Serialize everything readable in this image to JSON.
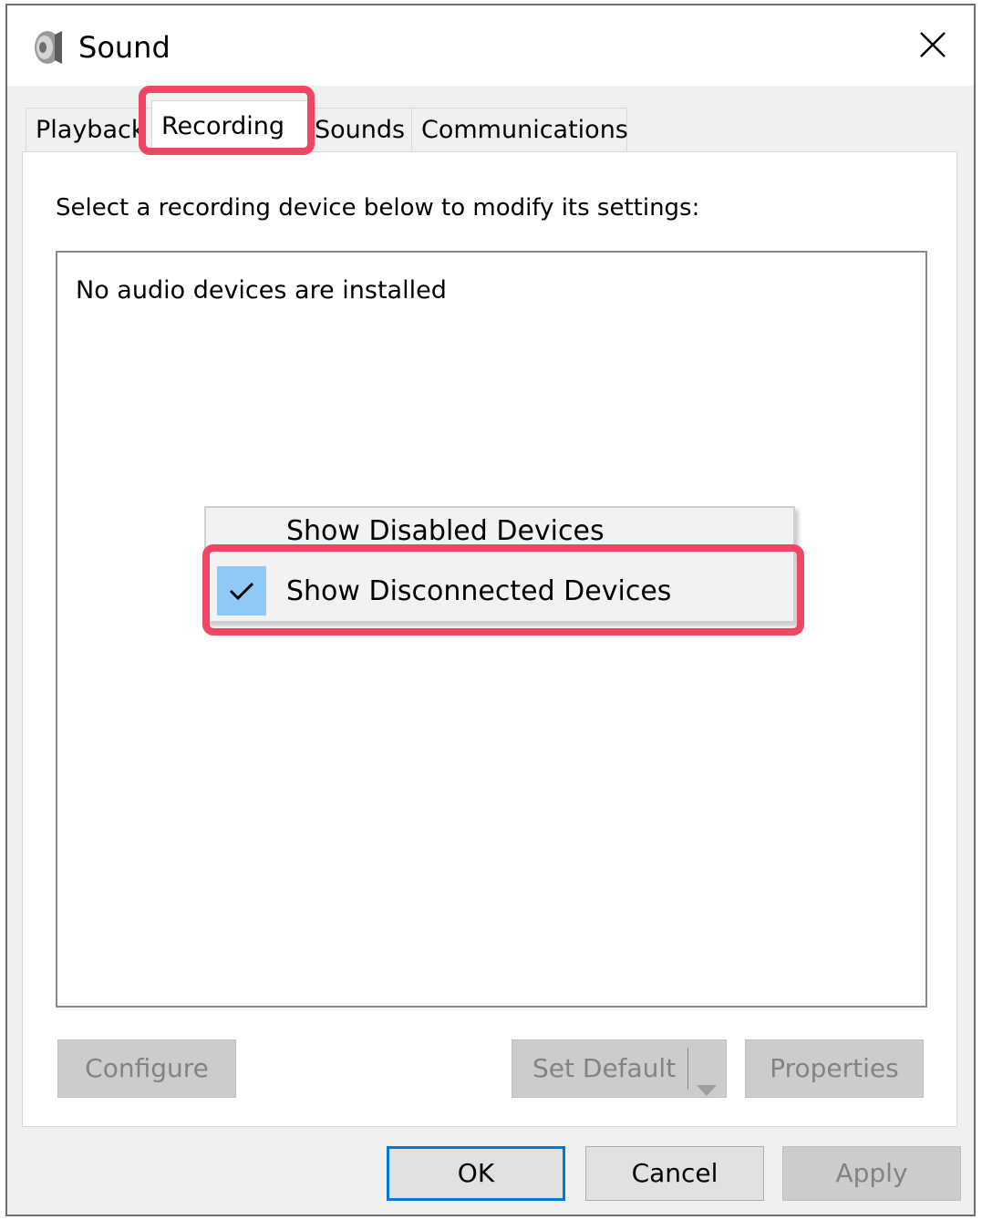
{
  "window": {
    "title": "Sound",
    "app_icon": "speaker-icon",
    "close_icon": "close-icon"
  },
  "tabs": [
    {
      "label": "Playback",
      "active": false
    },
    {
      "label": "Recording",
      "active": true
    },
    {
      "label": "Sounds",
      "active": false
    },
    {
      "label": "Communications",
      "active": false
    }
  ],
  "panel": {
    "instructions": "Select a recording device below to modify its settings:",
    "device_list_empty_text": "No audio devices are installed"
  },
  "context_menu": {
    "items": [
      {
        "label": "Show Disabled Devices",
        "checked": false
      },
      {
        "label": "Show Disconnected Devices",
        "checked": true,
        "icon": "checkmark-icon"
      }
    ]
  },
  "panel_buttons": {
    "configure": "Configure",
    "set_default": "Set Default",
    "set_default_arrow_icon": "dropdown-arrow-icon",
    "properties": "Properties"
  },
  "dialog_buttons": {
    "ok": "OK",
    "cancel": "Cancel",
    "apply": "Apply"
  },
  "colors": {
    "highlight": "#ef4664",
    "menu_check_bg": "#90c8f6",
    "focus_border": "#0078d7"
  }
}
